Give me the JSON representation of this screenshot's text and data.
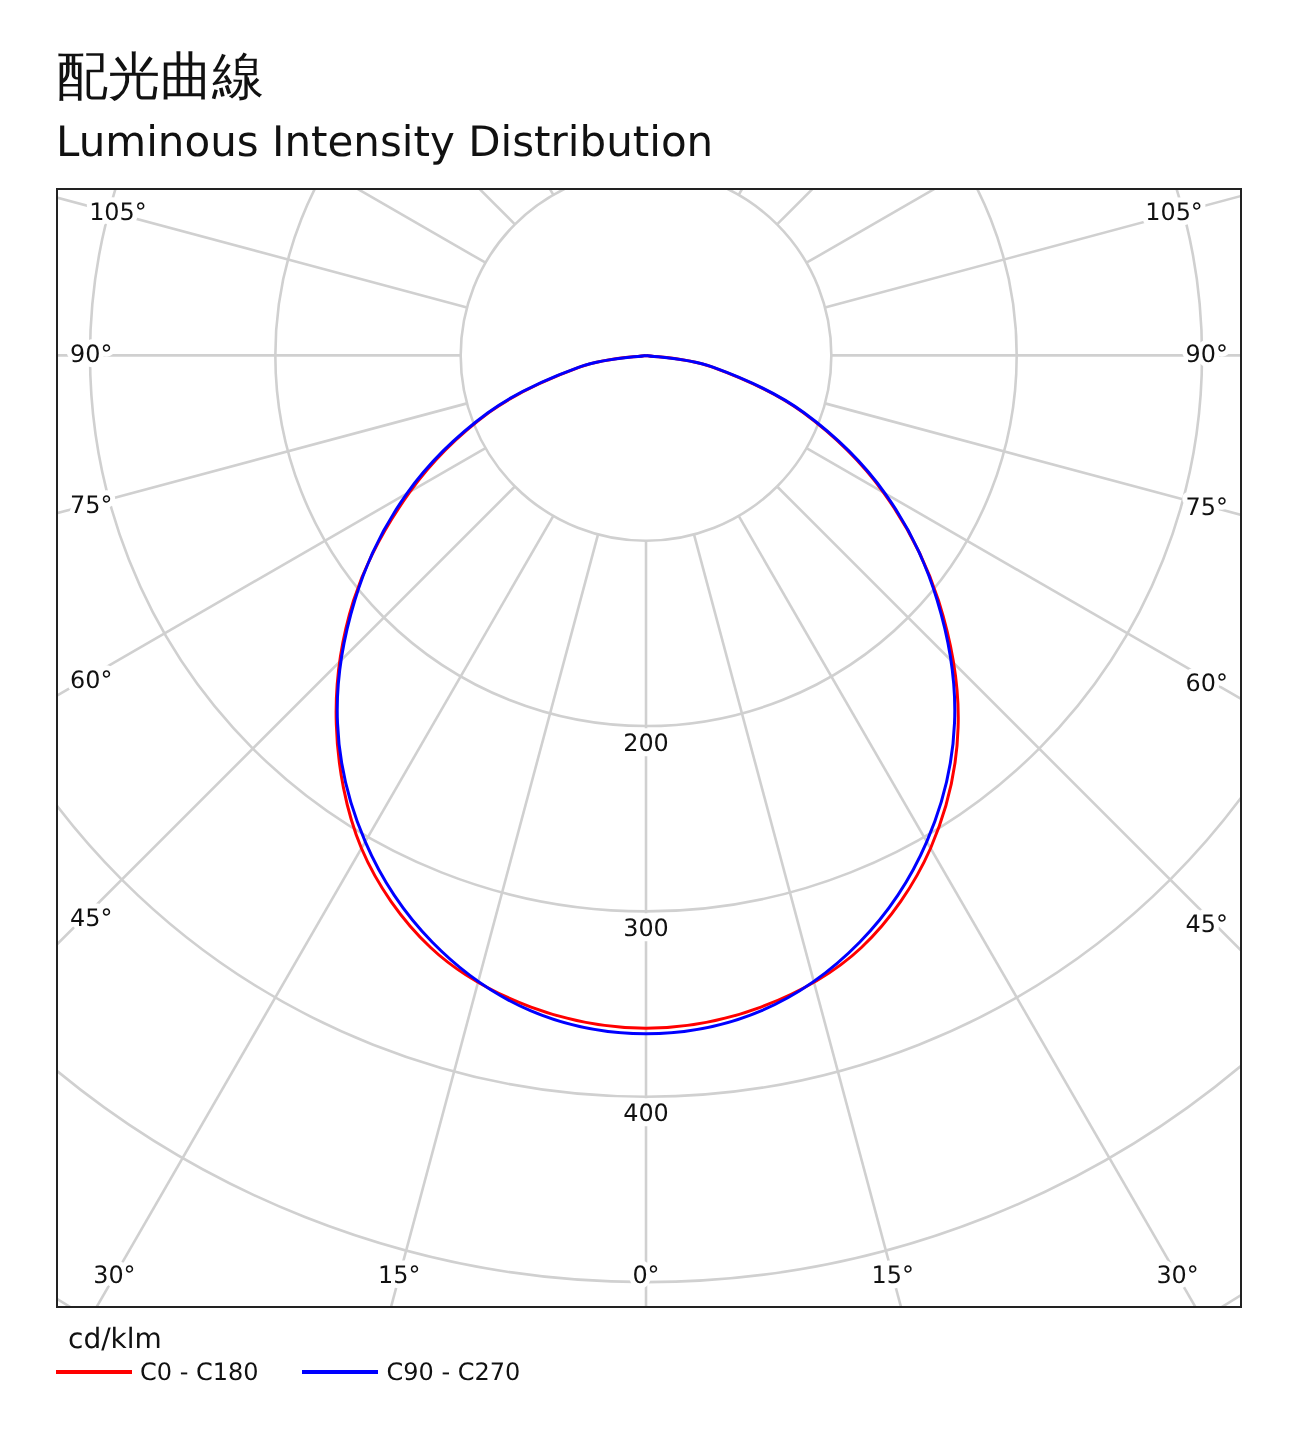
{
  "heading": {
    "title": "配光曲線",
    "subtitle": "Luminous Intensity Distribution"
  },
  "polar_plot": {
    "left_angle_labels": [
      "105°",
      "90°",
      "75°",
      "60°",
      "45°"
    ],
    "right_angle_labels": [
      "105°",
      "90°",
      "75°",
      "60°",
      "45°"
    ],
    "radial_labels": [
      "200",
      "300",
      "400"
    ],
    "bottom_angle_labels": [
      "30°",
      "15°",
      "0°",
      "15°",
      "30°"
    ],
    "unit": "cd/klm",
    "legend": [
      {
        "name": "C0 - C180",
        "color": "#ff0000"
      },
      {
        "name": "C90 - C270",
        "color": "#0000ff"
      }
    ]
  }
}
